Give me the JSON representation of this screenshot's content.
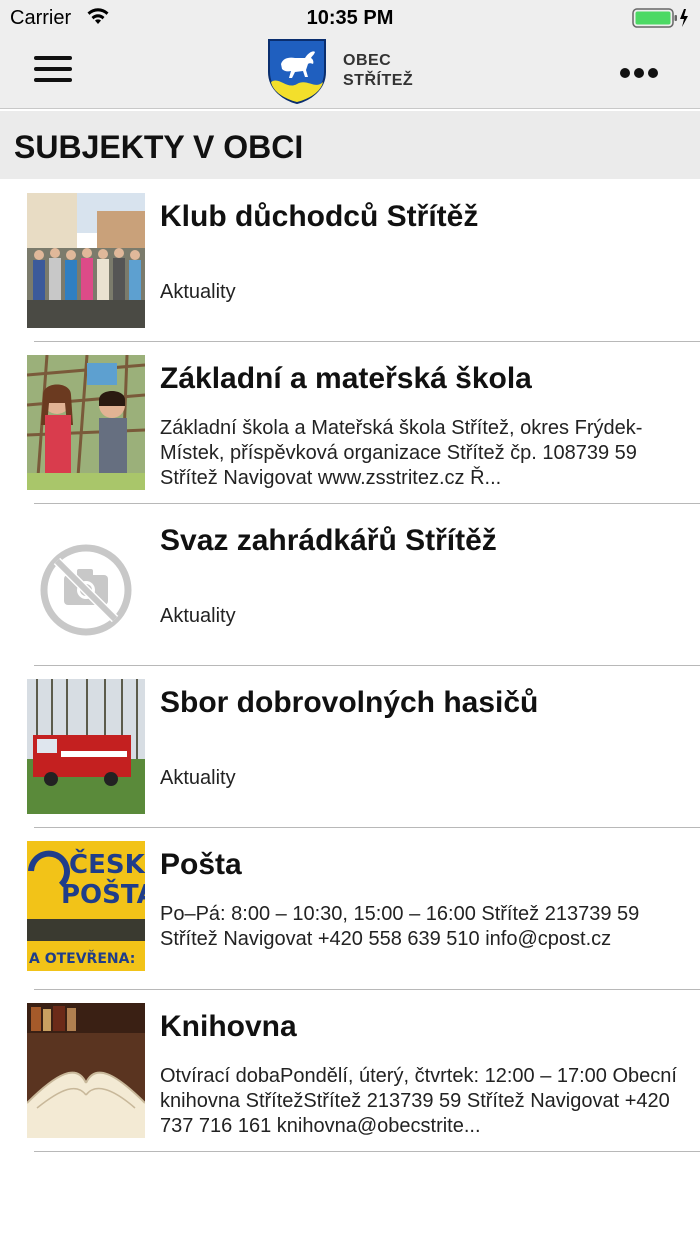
{
  "status": {
    "carrier": "Carrier",
    "time": "10:35 PM"
  },
  "header": {
    "brand_line1": "OBEC",
    "brand_line2": "STŘÍTEŽ"
  },
  "section": {
    "title": "SUBJEKTY V OBCI"
  },
  "items": [
    {
      "title": "Klub důchodců Střítěž",
      "desc": "Aktuality",
      "thumb": "people-photo"
    },
    {
      "title": "Základní a mateřská škola",
      "desc": "Základní škola a Mateřská škola Střítež, okres Frýdek-Místek, příspěvková organizace  Střítež čp. 108739 59 Střítež   Navigovat  www.zsstritez.cz  Ř...",
      "thumb": "children-photo"
    },
    {
      "title": "Svaz zahrádkářů Střítěž",
      "desc": "Aktuality",
      "thumb": "no-photo-icon"
    },
    {
      "title": "Sbor dobrovolných hasičů",
      "desc": "Aktuality",
      "thumb": "fire-truck-photo"
    },
    {
      "title": "Pošta",
      "desc": "Po–Pá: 8:00 – 10:30, 15:00 – 16:00  Střítež 213739 59 Střítež   Navigovat  +420 558 639 510  info@cpost.cz",
      "thumb": "post-office-photo",
      "sign1": "ČESK",
      "sign2": "POŠTA",
      "sign3": "A OTEVŘENA:"
    },
    {
      "title": "Knihovna",
      "desc": "Otvírací dobaPondělí, úterý, čtvrtek: 12:00 – 17:00 Obecní knihovna StřítežStřítež 213739 59 Střítež Navigovat  +420 737 716 161  knihovna@obecstrite...",
      "thumb": "book-photo"
    }
  ]
}
